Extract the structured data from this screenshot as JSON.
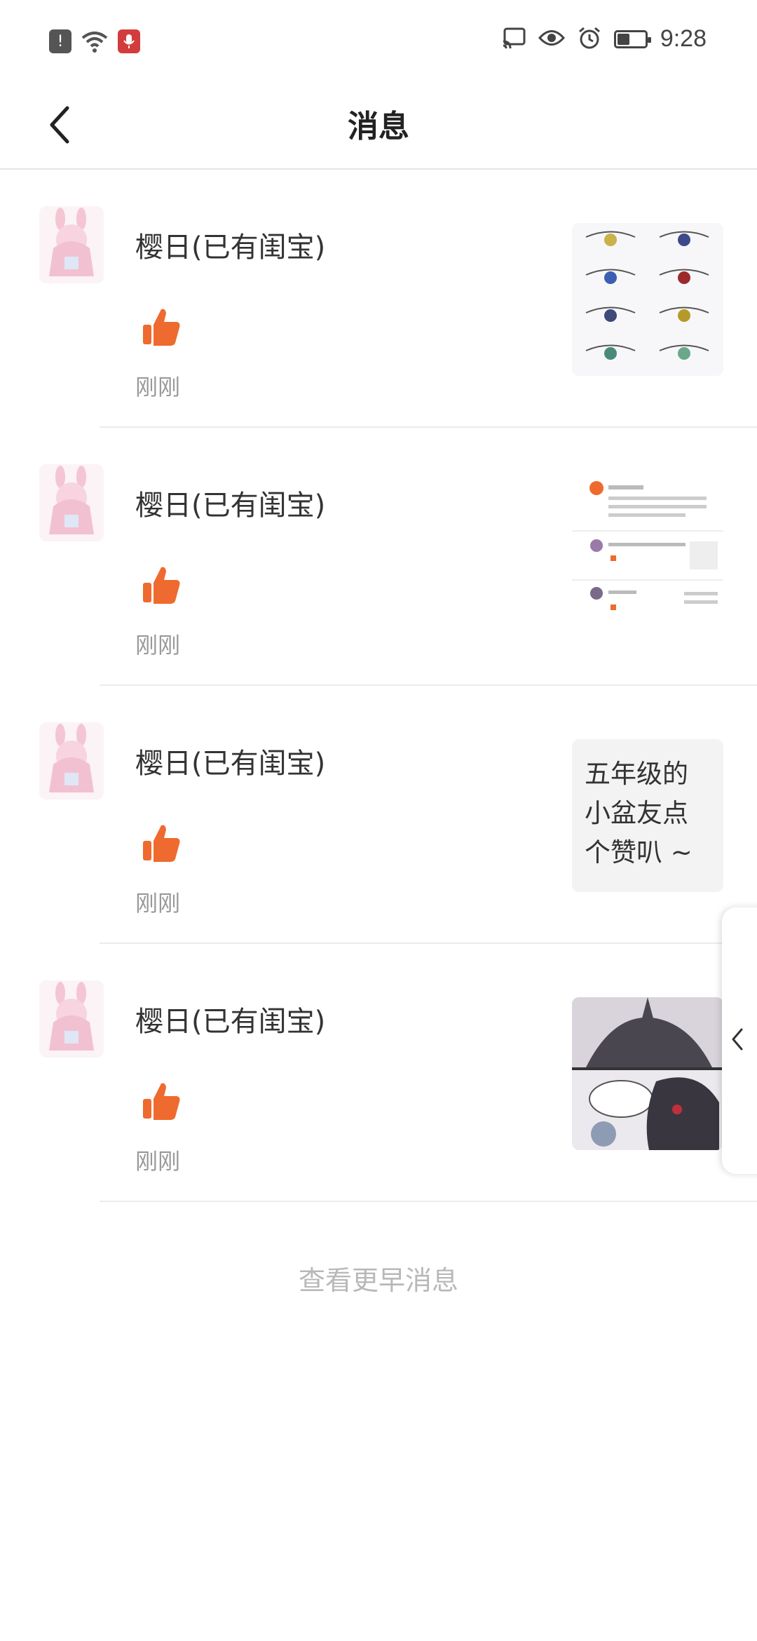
{
  "status_bar": {
    "time": "9:28",
    "left_icons": [
      "alert-icon",
      "wifi-icon",
      "mic-icon"
    ],
    "right_icons": [
      "cast-icon",
      "eye-icon",
      "alarm-icon",
      "battery-icon"
    ]
  },
  "header": {
    "title": "消息",
    "back_icon": "chevron-left-icon"
  },
  "messages": [
    {
      "username": "樱日(已有闺宝)",
      "time": "刚刚",
      "thumb_type": "image",
      "thumb_desc": "eyes-sketch"
    },
    {
      "username": "樱日(已有闺宝)",
      "time": "刚刚",
      "thumb_type": "image",
      "thumb_desc": "screenshot"
    },
    {
      "username": "樱日(已有闺宝)",
      "time": "刚刚",
      "thumb_type": "text",
      "thumb_text": "五年级的小盆友点个赞叭 ~"
    },
    {
      "username": "樱日(已有闺宝)",
      "time": "刚刚",
      "thumb_type": "image",
      "thumb_desc": "comic"
    }
  ],
  "footer": {
    "load_earlier": "查看更早消息"
  },
  "colors": {
    "like": "#ef6a2e",
    "muted_text": "#999999",
    "divider": "#ebebeb"
  }
}
